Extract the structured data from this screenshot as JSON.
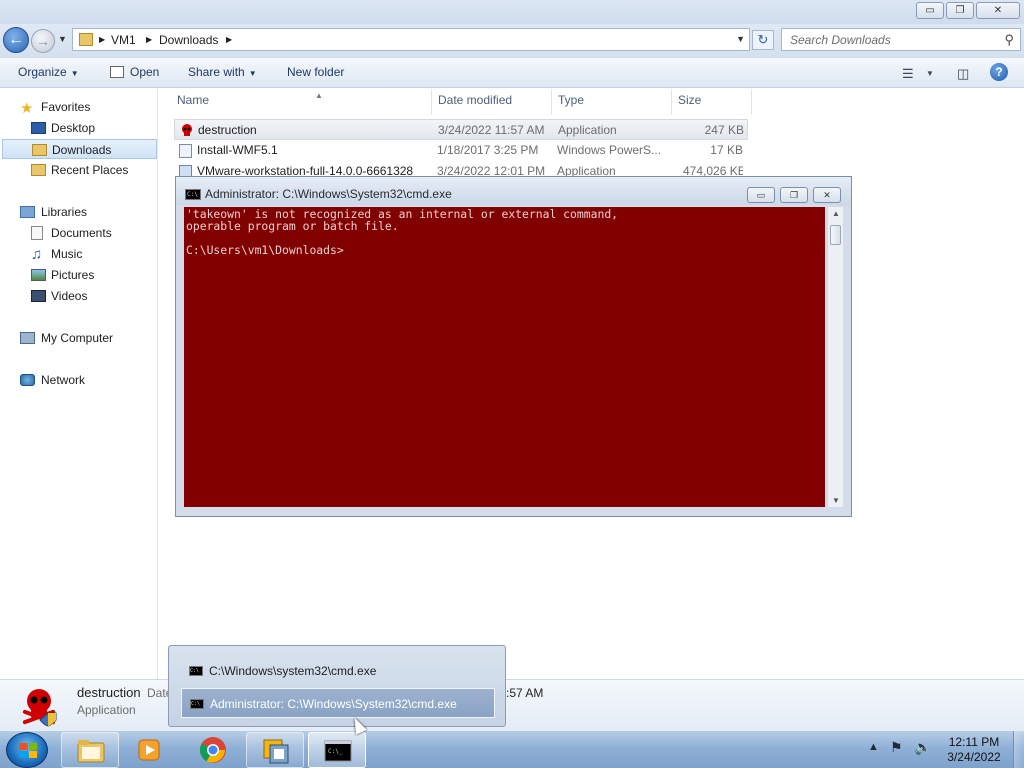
{
  "explorer": {
    "window_buttons": {
      "minimize": "▭",
      "maximize": "❐",
      "close": "✕"
    },
    "address": {
      "crumbs": [
        "VM1",
        "Downloads"
      ]
    },
    "search": {
      "placeholder": "Search Downloads"
    },
    "toolbar": {
      "organize": "Organize",
      "open": "Open",
      "share_with": "Share with",
      "new_folder": "New folder"
    },
    "nav": {
      "favorites": "Favorites",
      "desktop": "Desktop",
      "downloads": "Downloads",
      "recent_places": "Recent Places",
      "libraries": "Libraries",
      "documents": "Documents",
      "music": "Music",
      "pictures": "Pictures",
      "videos": "Videos",
      "my_computer": "My Computer",
      "network": "Network"
    },
    "columns": {
      "name": "Name",
      "date_modified": "Date modified",
      "type": "Type",
      "size": "Size"
    },
    "files": [
      {
        "name": "destruction",
        "date": "3/24/2022 11:57 AM",
        "type": "Application",
        "size": "247 KB"
      },
      {
        "name": "Install-WMF5.1",
        "date": "1/18/2017 3:25 PM",
        "type": "Windows PowerS...",
        "size": "17 KB"
      },
      {
        "name": "VMware-workstation-full-14.0.0-6661328",
        "date": "3/24/2022 12:01 PM",
        "type": "Application",
        "size": "474,026 KB"
      }
    ],
    "details": {
      "name": "destruction",
      "date_label": "Date",
      "type": "Application",
      "time_fragment": ":57 AM"
    }
  },
  "cmd": {
    "title": "Administrator: C:\\Windows\\System32\\cmd.exe",
    "lines": [
      "'takeown' is not recognized as an internal or external command,",
      "operable program or batch file.",
      "",
      "C:\\Users\\vm1\\Downloads>"
    ],
    "background_color": "#800000"
  },
  "taskbar_popup": {
    "items": [
      "C:\\Windows\\system32\\cmd.exe",
      "Administrator: C:\\Windows\\System32\\cmd.exe"
    ]
  },
  "taskbar": {
    "clock_time": "12:11 PM",
    "clock_date": "3/24/2022",
    "icons": [
      "start-orb",
      "file-explorer-icon",
      "media-player-icon",
      "chrome-icon",
      "vmware-icon",
      "cmd-icon"
    ]
  }
}
